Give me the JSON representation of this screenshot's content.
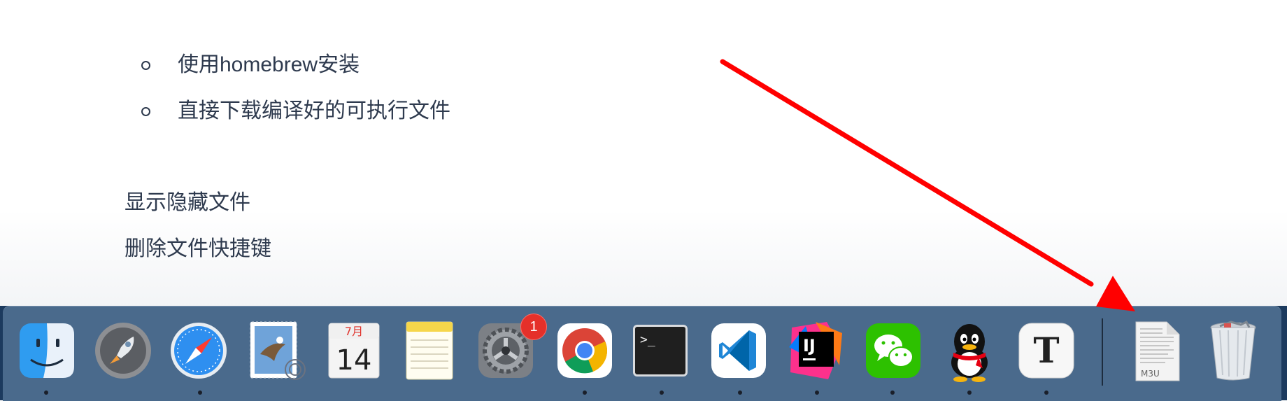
{
  "document": {
    "bullets": [
      "使用homebrew安装",
      "直接下载编译好的可执行文件"
    ],
    "paragraphs": [
      "显示隐藏文件",
      "删除文件快捷键"
    ]
  },
  "dock": {
    "apps": [
      {
        "name": "Finder",
        "icon": "finder-icon",
        "running": true
      },
      {
        "name": "Launchpad",
        "icon": "rocket-icon",
        "running": false
      },
      {
        "name": "Safari",
        "icon": "compass-icon",
        "running": true
      },
      {
        "name": "Mail",
        "icon": "eagle-stamp-icon",
        "running": false
      },
      {
        "name": "Calendar",
        "icon": "calendar-icon",
        "running": false,
        "month": "7月",
        "day": "14"
      },
      {
        "name": "Notes",
        "icon": "notepad-icon",
        "running": false
      },
      {
        "name": "System Preferences",
        "icon": "gear-icon",
        "running": false,
        "badge": "1"
      },
      {
        "name": "Google Chrome",
        "icon": "chrome-icon",
        "running": true
      },
      {
        "name": "Terminal",
        "icon": "terminal-icon",
        "running": true,
        "prompt": ">_"
      },
      {
        "name": "Visual Studio Code",
        "icon": "vscode-icon",
        "running": true
      },
      {
        "name": "IntelliJ IDEA",
        "icon": "intellij-icon",
        "running": true,
        "label": "IJ"
      },
      {
        "name": "WeChat",
        "icon": "wechat-icon",
        "running": true
      },
      {
        "name": "QQ",
        "icon": "penguin-icon",
        "running": true
      },
      {
        "name": "Typora",
        "icon": "typora-icon",
        "running": true,
        "label": "T"
      }
    ],
    "file": {
      "name": "M3U file",
      "icon": "document-icon",
      "label": "M3U"
    },
    "trash": {
      "name": "Trash",
      "icon": "trash-icon"
    }
  },
  "colors": {
    "annotation_arrow": "#ff0000",
    "dock_bg": "#4a6a8c",
    "text": "#2e3a4e"
  }
}
